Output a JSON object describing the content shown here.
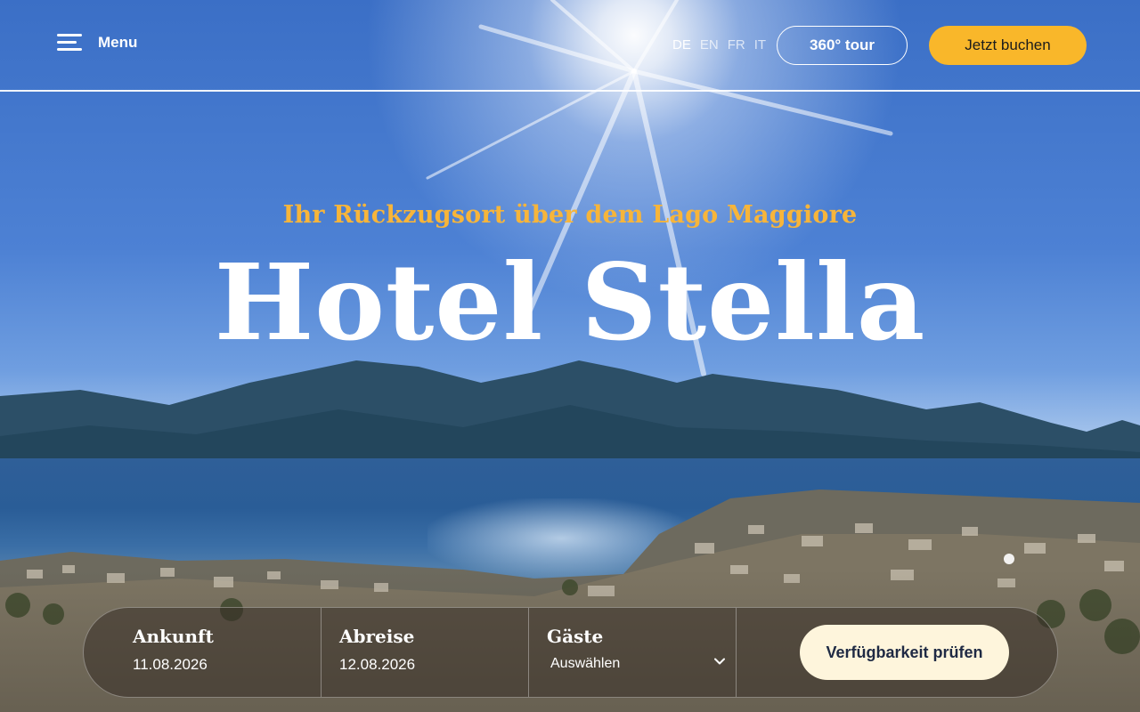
{
  "header": {
    "menu_label": "Menu",
    "languages": [
      {
        "code": "DE",
        "active": true
      },
      {
        "code": "EN",
        "active": false
      },
      {
        "code": "FR",
        "active": false
      },
      {
        "code": "IT",
        "active": false
      }
    ],
    "tour_label": "360° tour",
    "book_label": "Jetzt buchen"
  },
  "hero": {
    "tagline": "Ihr Rückzugsort über dem Lago Maggiore",
    "title": "Hotel Stella"
  },
  "booking": {
    "arrival": {
      "label": "Ankunft",
      "value": "11.08.2026"
    },
    "departure": {
      "label": "Abreise",
      "value": "12.08.2026"
    },
    "guests": {
      "label": "Gäste",
      "value": "Auswählen"
    },
    "submit_label": "Verfügbarkeit prüfen"
  },
  "colors": {
    "accent": "#f9b72a",
    "tagline": "#f7b53a",
    "submit_bg": "#fef5dc"
  }
}
